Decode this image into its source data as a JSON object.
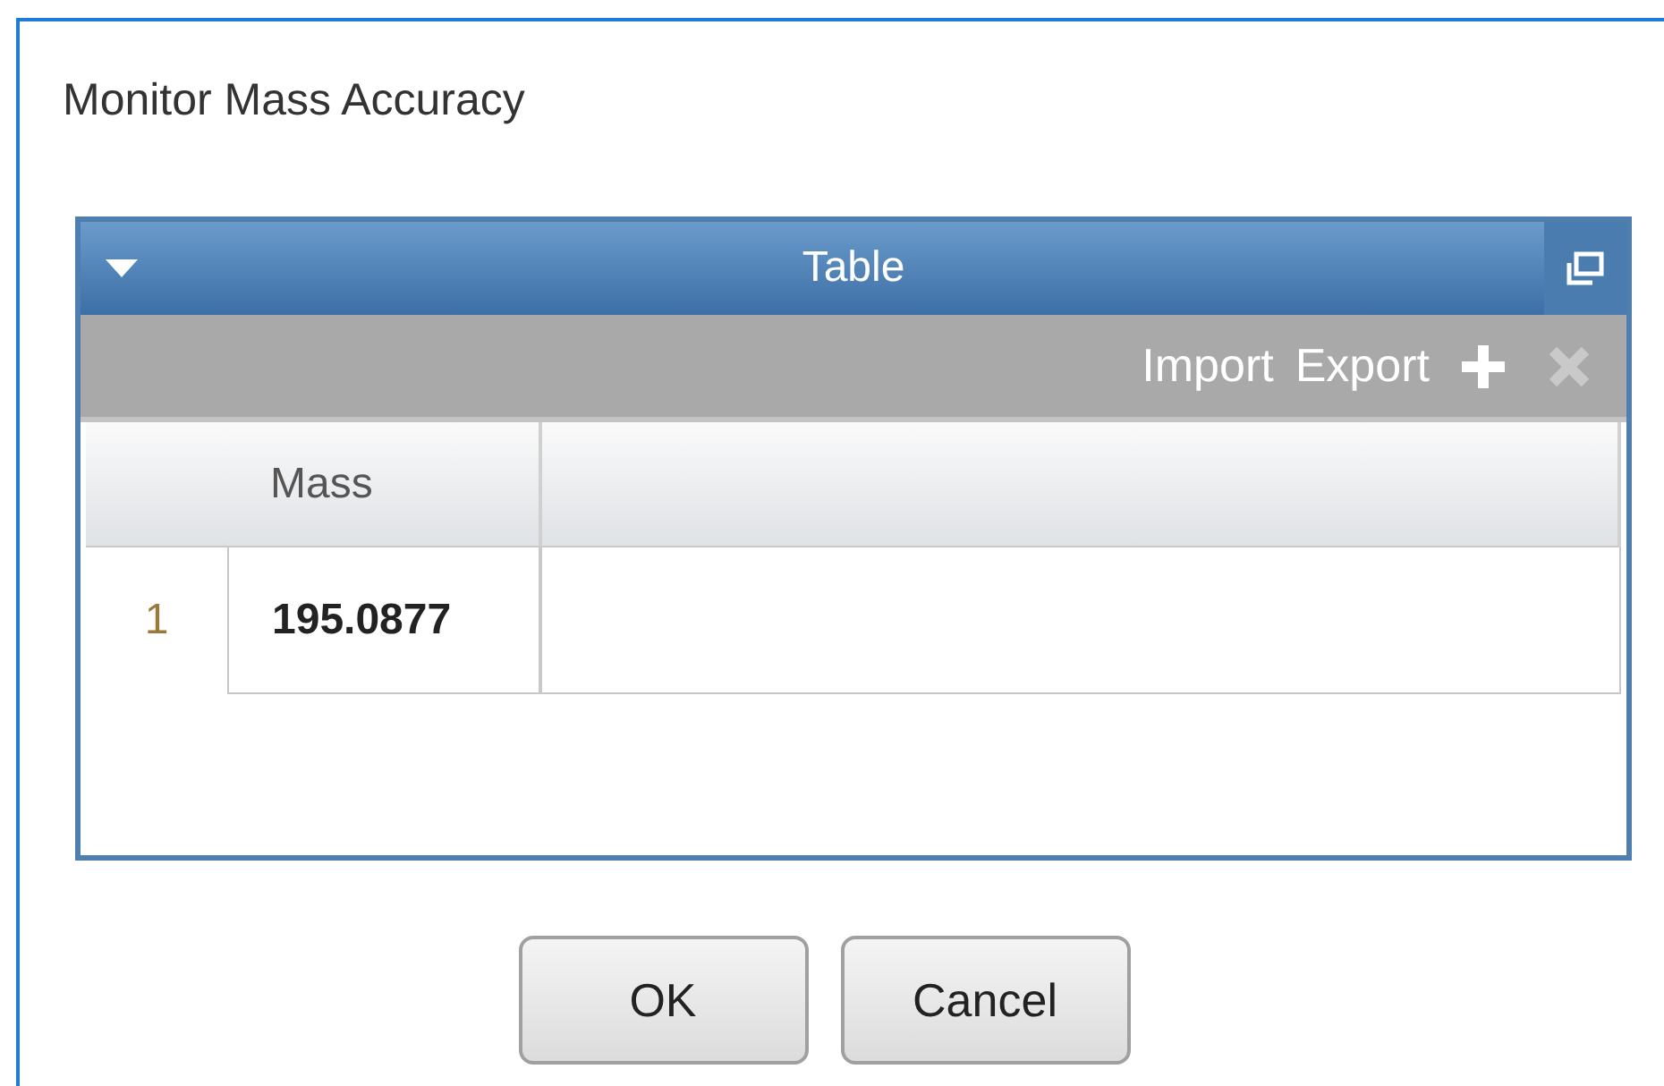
{
  "dialog": {
    "title": "Monitor Mass Accuracy"
  },
  "panel": {
    "title": "Table",
    "collapsed": false
  },
  "toolbar": {
    "actions": [
      {
        "label": "Import"
      },
      {
        "label": "Export"
      }
    ],
    "add_disabled": false,
    "remove_disabled": true
  },
  "table": {
    "columns": [
      "Mass"
    ],
    "rows": [
      {
        "number": "1",
        "cells": [
          "195.0877"
        ]
      }
    ]
  },
  "buttons": [
    {
      "label": "OK"
    },
    {
      "label": "Cancel"
    }
  ]
}
